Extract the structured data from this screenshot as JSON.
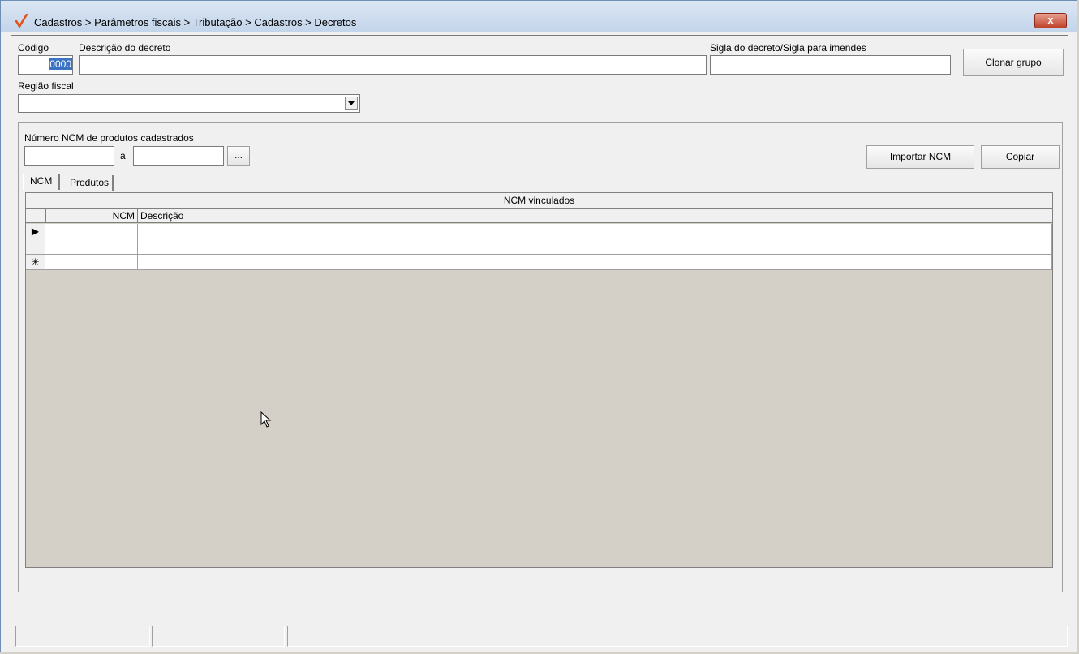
{
  "window": {
    "title": "Cadastros > Parâmetros fiscais > Tributação > Cadastros > Decretos",
    "close_label": "x",
    "accent_color": "#e0541f"
  },
  "form": {
    "codigo_label": "Código",
    "codigo_value": "0000",
    "descricao_label": "Descrição do decreto",
    "descricao_value": "",
    "sigla_label": "Sigla do decreto/Sigla para imendes",
    "sigla_value": "",
    "clonar_button": "Clonar grupo",
    "regiao_label": "Região fiscal",
    "regiao_value": ""
  },
  "ncm_filter": {
    "label": "Número  NCM de produtos cadastrados",
    "from_value": "",
    "to_label": "a",
    "to_value": "",
    "ellipsis_button": "...",
    "importar_button": "Importar NCM",
    "copiar_button": "Copiar"
  },
  "tabs": [
    {
      "label": "NCM",
      "active": true
    },
    {
      "label": "Produtos",
      "active": false
    }
  ],
  "grid": {
    "title": "NCM vinculados",
    "columns": [
      "NCM",
      "Descrição"
    ],
    "rows": [
      {
        "indicator": "▶",
        "ncm": "",
        "descricao": ""
      },
      {
        "indicator": "",
        "ncm": "",
        "descricao": ""
      },
      {
        "indicator": "✳",
        "ncm": "",
        "descricao": ""
      }
    ]
  },
  "statusbar": {
    "panes": [
      "",
      "",
      ""
    ]
  }
}
